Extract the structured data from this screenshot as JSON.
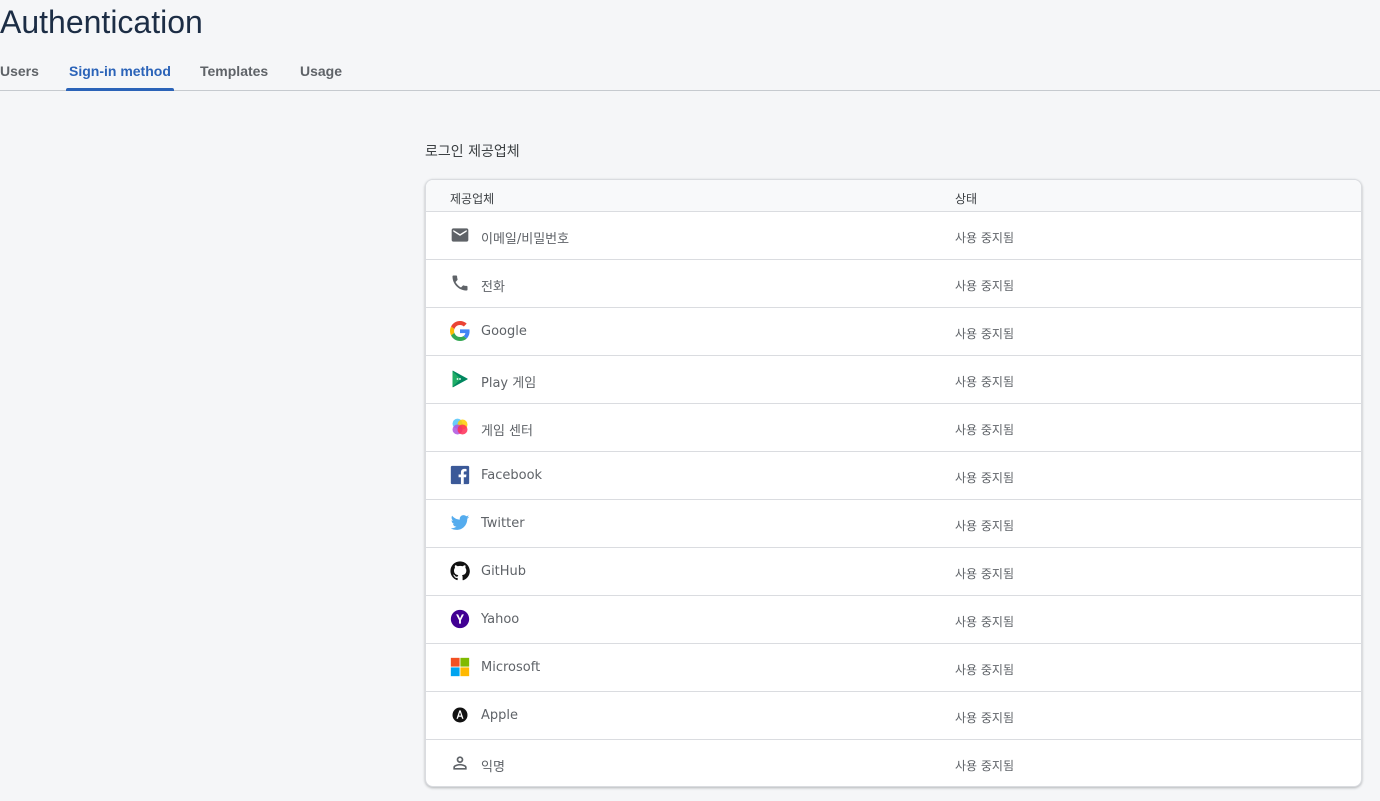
{
  "page_title": "Authentication",
  "tabs": [
    {
      "label": "Users",
      "active": false
    },
    {
      "label": "Sign-in method",
      "active": true
    },
    {
      "label": "Templates",
      "active": false
    },
    {
      "label": "Usage",
      "active": false
    }
  ],
  "section_label": "로그인 제공업체",
  "table": {
    "headers": {
      "provider": "제공업체",
      "status": "상태"
    },
    "rows": [
      {
        "icon": "email-icon",
        "name": "이메일/비밀번호",
        "status": "사용 중지됨"
      },
      {
        "icon": "phone-icon",
        "name": "전화",
        "status": "사용 중지됨"
      },
      {
        "icon": "google-icon",
        "name": "Google",
        "status": "사용 중지됨"
      },
      {
        "icon": "play-games-icon",
        "name": "Play 게임",
        "status": "사용 중지됨"
      },
      {
        "icon": "game-center-icon",
        "name": "게임 센터",
        "status": "사용 중지됨"
      },
      {
        "icon": "facebook-icon",
        "name": "Facebook",
        "status": "사용 중지됨"
      },
      {
        "icon": "twitter-icon",
        "name": "Twitter",
        "status": "사용 중지됨"
      },
      {
        "icon": "github-icon",
        "name": "GitHub",
        "status": "사용 중지됨"
      },
      {
        "icon": "yahoo-icon",
        "name": "Yahoo",
        "status": "사용 중지됨"
      },
      {
        "icon": "microsoft-icon",
        "name": "Microsoft",
        "status": "사용 중지됨"
      },
      {
        "icon": "apple-icon",
        "name": "Apple",
        "status": "사용 중지됨"
      },
      {
        "icon": "anonymous-icon",
        "name": "익명",
        "status": "사용 중지됨"
      }
    ]
  },
  "colors": {
    "accent": "#2b63b8",
    "title": "#1c2d45",
    "background": "#f5f6f8"
  }
}
